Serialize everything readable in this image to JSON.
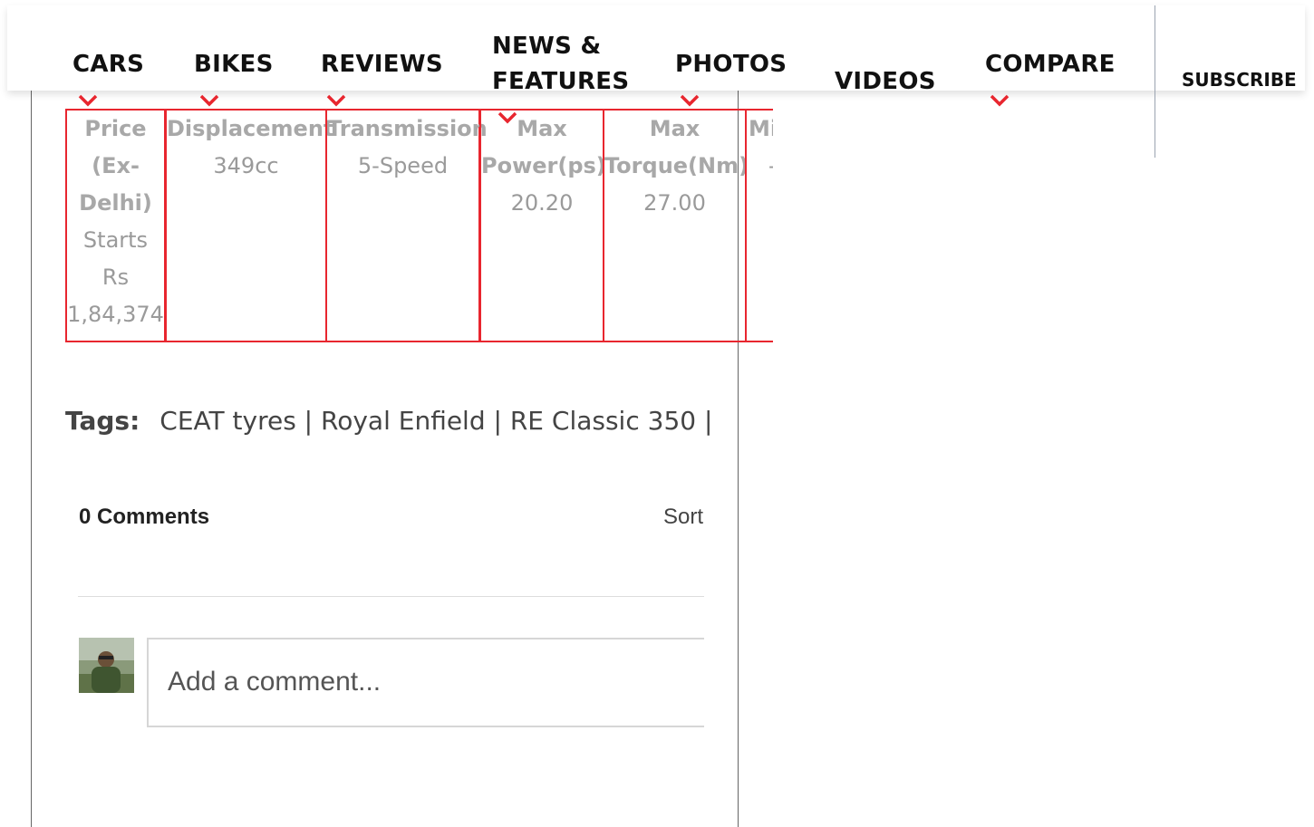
{
  "nav": {
    "cars": "CARS",
    "bikes": "BIKES",
    "reviews": "REVIEWS",
    "news_line1": "NEWS &",
    "news_line2": "FEATURES",
    "photos": "PHOTOS",
    "videos": "VIDEOS",
    "compare": "COMPARE",
    "subscribe": "SUBSCRIBE",
    "accent_color": "#e8262f"
  },
  "specs": [
    {
      "label_lines": [
        "Price",
        "(Ex-",
        "Delhi)"
      ],
      "value_lines": [
        "Starts",
        "Rs",
        "1,84,374"
      ]
    },
    {
      "label_lines": [
        "Displacement"
      ],
      "value_lines": [
        "349cc"
      ]
    },
    {
      "label_lines": [
        "Transmission"
      ],
      "value_lines": [
        "5-Speed"
      ]
    },
    {
      "label_lines": [
        "Max",
        "Power(ps)"
      ],
      "value_lines": [
        "20.20"
      ]
    },
    {
      "label_lines": [
        "Max",
        "Torque(Nm)"
      ],
      "value_lines": [
        "27.00"
      ]
    },
    {
      "label_lines": [
        "Mi"
      ],
      "value_lines": [
        "-"
      ]
    }
  ],
  "tags": {
    "label": "Tags:",
    "text": "CEAT tyres | Royal Enfield | RE Classic 350 |"
  },
  "comments": {
    "title": "0 Comments",
    "sort": "Sort",
    "placeholder": "Add a comment..."
  }
}
